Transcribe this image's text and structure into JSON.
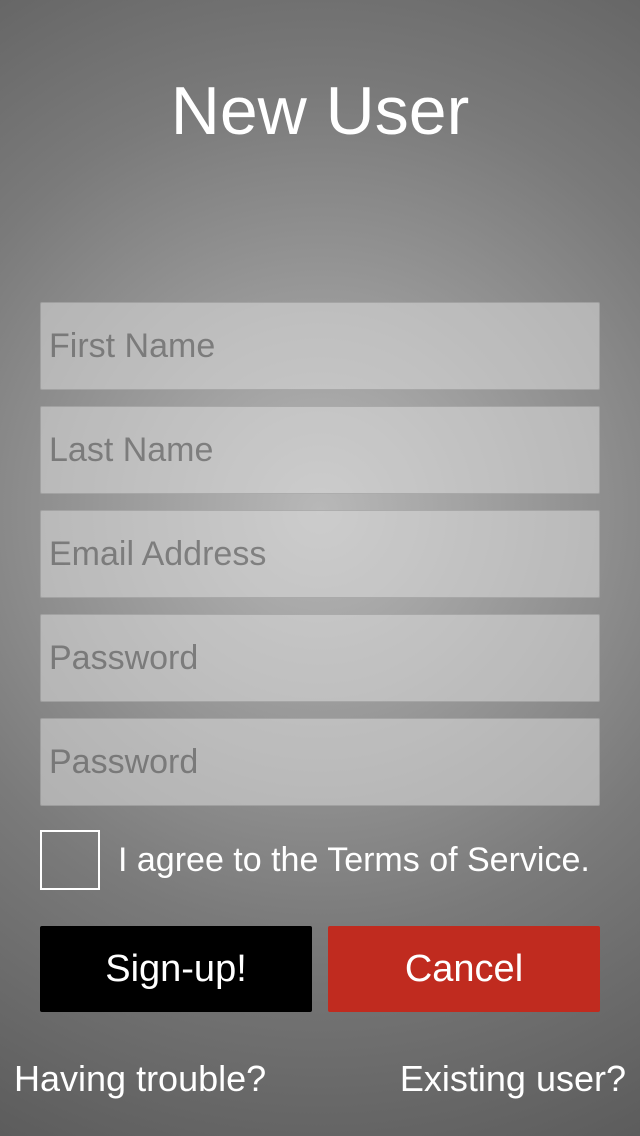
{
  "title": "New User",
  "fields": {
    "first_name": {
      "placeholder": "First Name",
      "value": ""
    },
    "last_name": {
      "placeholder": "Last Name",
      "value": ""
    },
    "email": {
      "placeholder": "Email Address",
      "value": ""
    },
    "password": {
      "placeholder": "Password",
      "value": ""
    },
    "password_confirm": {
      "placeholder": "Password",
      "value": ""
    }
  },
  "agree": {
    "label": "I agree to the Terms of Service.",
    "checked": false
  },
  "buttons": {
    "signup": "Sign-up!",
    "cancel": "Cancel"
  },
  "footer": {
    "trouble": "Having trouble?",
    "existing": "Existing user?"
  },
  "colors": {
    "signup_bg": "#000000",
    "cancel_bg": "#c02b1f"
  }
}
